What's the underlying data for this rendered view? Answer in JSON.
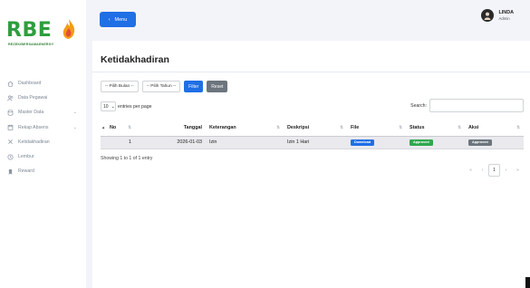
{
  "brand": {
    "logo": "RBE",
    "tagline": "REZEKIBERSAMAENERGY"
  },
  "sidebar": {
    "items": [
      {
        "label": "Dashboard",
        "icon": "home-icon",
        "has_submenu": false
      },
      {
        "label": "Data Pegawai",
        "icon": "users-icon",
        "has_submenu": false
      },
      {
        "label": "Master Data",
        "icon": "database-icon",
        "has_submenu": true
      },
      {
        "label": "Rekap Absens",
        "icon": "calendar-icon",
        "has_submenu": true
      },
      {
        "label": "Ketidakhadiran",
        "icon": "x-icon",
        "has_submenu": false
      },
      {
        "label": "Lembur",
        "icon": "clock-icon",
        "has_submenu": false
      },
      {
        "label": "Reward",
        "icon": "award-icon",
        "has_submenu": false
      }
    ]
  },
  "topbar": {
    "menu_label": "Menu",
    "user_name": "LINDA",
    "user_role": "Admin"
  },
  "page": {
    "title": "Ketidakhadiran"
  },
  "filters": {
    "month_placeholder": "-- Pilih Bulan --",
    "year_placeholder": "-- Pilih Tahun --",
    "filter_label": "Filter",
    "reset_label": "Reset"
  },
  "table_controls": {
    "length_value": "10",
    "length_suffix": "entries per page",
    "search_label": "Search:",
    "search_value": ""
  },
  "table": {
    "columns": [
      "No",
      "Tanggal",
      "Keterangan",
      "Deskripsi",
      "File",
      "Status",
      "Aksi"
    ],
    "rows": [
      {
        "no": "1",
        "tanggal": "2026-01-03",
        "keterangan": "Izin",
        "deskripsi": "Izin 1 Hari",
        "file": "Download",
        "status": "Approved",
        "aksi": "Approved"
      }
    ]
  },
  "footer": {
    "info": "Showing 1 to 1 of 1 entry",
    "pager": {
      "first": "«",
      "prev": "‹",
      "current": "1",
      "next": "›",
      "last": "»"
    }
  },
  "colors": {
    "primary": "#1f6fe5",
    "success": "#2fa84f",
    "secondary": "#6c757d",
    "brand_green": "#2e9e3e"
  }
}
